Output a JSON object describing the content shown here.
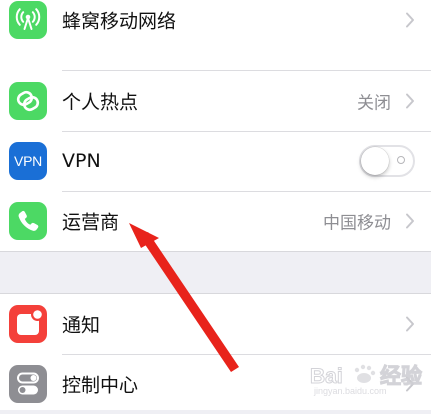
{
  "settings": {
    "group_1": [
      {
        "key": "cellular",
        "label": "蜂窝移动网络",
        "value": "",
        "icon": "antenna-icon",
        "icon_color": "#4cd964",
        "control": "chevron"
      },
      {
        "key": "hotspot",
        "label": "个人热点",
        "value": "关闭",
        "icon": "chain-link-icon",
        "icon_color": "#4cd964",
        "control": "chevron"
      },
      {
        "key": "vpn",
        "label": "VPN",
        "value": "",
        "icon": "vpn-icon",
        "icon_text": "VPN",
        "icon_color": "#1a6fd6",
        "control": "toggle",
        "toggle_on": false
      },
      {
        "key": "carrier",
        "label": "运营商",
        "value": "中国移动",
        "icon": "phone-icon",
        "icon_color": "#4cd964",
        "control": "chevron"
      }
    ],
    "group_2": [
      {
        "key": "notifications",
        "label": "通知",
        "value": "",
        "icon": "notification-badge-icon",
        "icon_color": "#f4403a",
        "control": "chevron"
      },
      {
        "key": "control_center",
        "label": "控制中心",
        "value": "",
        "icon": "switches-icon",
        "icon_color": "#8e8e93",
        "control": "chevron"
      }
    ]
  },
  "annotation": {
    "type": "arrow",
    "color": "#e8231b",
    "points_to": "carrier"
  },
  "watermark": {
    "text": "Baidu经验",
    "subtext": "jingyan.baidu.com"
  }
}
